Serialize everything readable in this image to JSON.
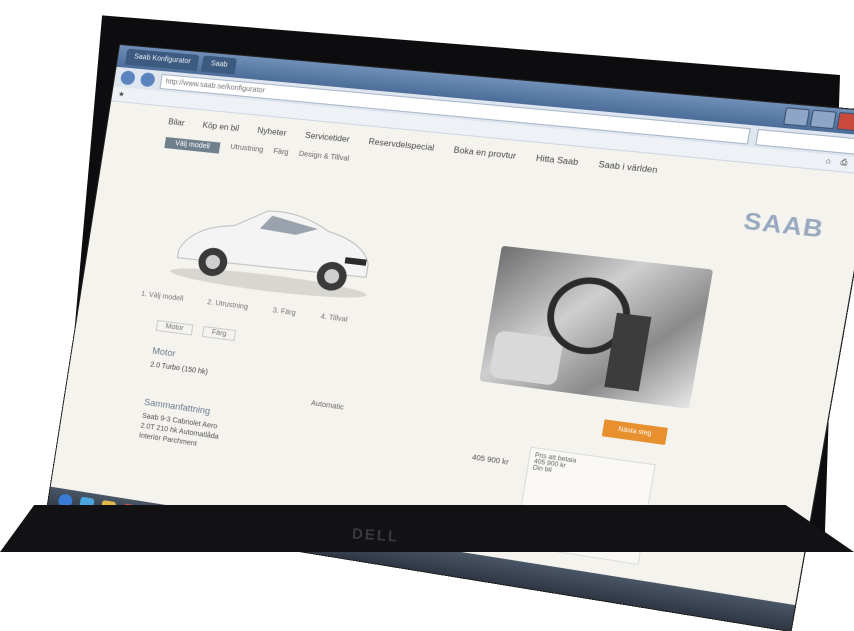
{
  "browser": {
    "tabs": [
      "Saab Konfigurator",
      "Saab"
    ],
    "url": "http://www.saab.se/konfigurator"
  },
  "site": {
    "logo": "SAAB",
    "nav": [
      "Bilar",
      "Köp en bil",
      "Nyheter",
      "Servicetider",
      "Reservdelspecial",
      "Boka en provtur",
      "Hitta Saab",
      "Saab i världen"
    ],
    "subnav": [
      "Välj modell",
      "Utrustning",
      "Färg",
      "Design & Tillval"
    ],
    "cta": "Nästa steg",
    "steps": [
      "1. Välj modell",
      "2. Utrustning",
      "3. Färg",
      "4. Tillval"
    ],
    "tabs": [
      "Motor",
      "Färg"
    ],
    "section_title": "Motor",
    "field_label": "2.0 Turbo (150 hk)",
    "field_value": "Automatic",
    "section2_title": "Sammanfattning",
    "list_items": [
      "Saab 9-3 Cabriolet Aero",
      "2.0T 210 hk Automatlåda",
      "Interiör Parchment"
    ],
    "price": "405 900 kr",
    "summary_lines": [
      "Pris att betala",
      "405 900 kr",
      "Din bil"
    ]
  },
  "laptop": {
    "brand": "DELL"
  },
  "colors": {
    "accent": "#e8902e",
    "logo": "#98a9bf"
  }
}
